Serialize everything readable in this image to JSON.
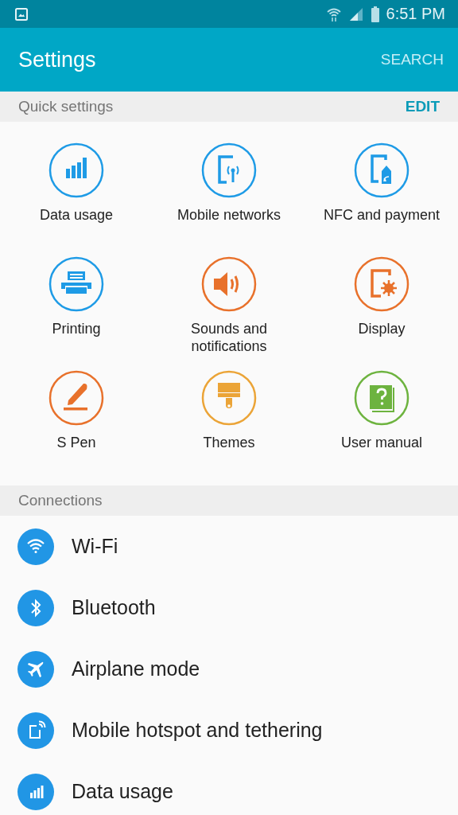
{
  "status_bar": {
    "time": "6:51 PM"
  },
  "app_bar": {
    "title": "Settings",
    "action": "SEARCH"
  },
  "quick_settings": {
    "header": "Quick settings",
    "action": "EDIT",
    "items": [
      {
        "label": "Data usage",
        "kind": "bars",
        "color": "#1e9be6"
      },
      {
        "label": "Mobile networks",
        "kind": "tablet-signal",
        "color": "#1e9be6"
      },
      {
        "label": "NFC and payment",
        "kind": "tablet-tag",
        "color": "#1e9be6"
      },
      {
        "label": "Printing",
        "kind": "printer",
        "color": "#1e9be6"
      },
      {
        "label": "Sounds and notifications",
        "kind": "speaker",
        "color": "#e8712b"
      },
      {
        "label": "Display",
        "kind": "tablet-gear",
        "color": "#e8712b"
      },
      {
        "label": "S Pen",
        "kind": "pen",
        "color": "#e8712b"
      },
      {
        "label": "Themes",
        "kind": "brush",
        "color": "#eba437"
      },
      {
        "label": "User manual",
        "kind": "book",
        "color": "#6db33f"
      }
    ]
  },
  "connections": {
    "header": "Connections",
    "items": [
      {
        "label": "Wi-Fi",
        "kind": "wifi"
      },
      {
        "label": "Bluetooth",
        "kind": "bluetooth"
      },
      {
        "label": "Airplane mode",
        "kind": "airplane"
      },
      {
        "label": "Mobile hotspot and tethering",
        "kind": "hotspot"
      },
      {
        "label": "Data usage",
        "kind": "bars"
      }
    ]
  }
}
